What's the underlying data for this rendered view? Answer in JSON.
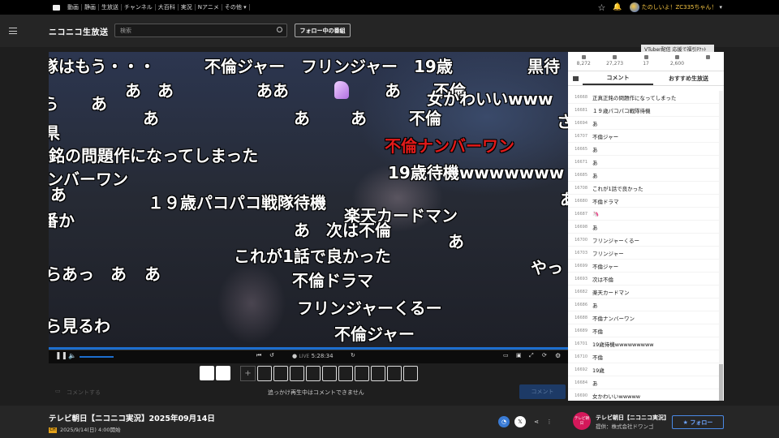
{
  "topbar": {
    "nav": [
      "動画",
      "静画",
      "生放送",
      "チャンネル",
      "大百科",
      "実況",
      "Nアニメ",
      "その他"
    ],
    "user_name": "たのしいよ！ZC335ちゃん！"
  },
  "header": {
    "logo": "ニコニコ生放送",
    "search_placeholder": "検索",
    "follow_programs": "フォロー中の番組"
  },
  "video": {
    "comments": [
      {
        "text": "隊はもう・・・",
        "size": 20
      },
      {
        "text": "不倫ジャー　フリンジャー　19歳",
        "size": 20
      },
      {
        "text": "黒待",
        "size": 20
      },
      {
        "text": "あ　あ",
        "size": 20
      },
      {
        "text": "ああ",
        "size": 20
      },
      {
        "text": "あ",
        "size": 20
      },
      {
        "text": "不倫",
        "size": 20
      },
      {
        "text": "あ",
        "size": 20
      },
      {
        "text": "女かわいいwww",
        "size": 20
      },
      {
        "text": "あ",
        "size": 20
      },
      {
        "text": "あ",
        "size": 20
      },
      {
        "text": "あ",
        "size": 20
      },
      {
        "text": "不倫",
        "size": 20
      },
      {
        "text": "不倫ナンバーワン",
        "size": 20,
        "color": "red"
      },
      {
        "text": "銘の問題作になってしまった",
        "size": 20
      },
      {
        "text": "19歳待機wwwwwww",
        "size": 20
      },
      {
        "text": "ンバーワン",
        "size": 20
      },
      {
        "text": "あ",
        "size": 20
      },
      {
        "text": "１９歳パコパコ戦隊待機",
        "size": 20
      },
      {
        "text": "番か",
        "size": 20
      },
      {
        "text": "楽天カードマン",
        "size": 20
      },
      {
        "text": "あ　次は不倫",
        "size": 20
      },
      {
        "text": "あ",
        "size": 20
      },
      {
        "text": "これが1話で良かった",
        "size": 20
      },
      {
        "text": "らあっ　あ",
        "size": 20
      },
      {
        "text": "やっ",
        "size": 20
      },
      {
        "text": "不倫ドラマ",
        "size": 20
      },
      {
        "text": "フリンジャーくるー",
        "size": 20
      },
      {
        "text": "ら見るわ",
        "size": 20
      },
      {
        "text": "不倫ジャー",
        "size": 20
      },
      {
        "text": "さ",
        "size": 20
      },
      {
        "text": "あ",
        "size": 20
      },
      {
        "text": "あ",
        "size": 20
      }
    ],
    "live_label": "LIVE",
    "time": "5:28:34"
  },
  "comment_bar": {
    "placeholder": "コメントする",
    "disabled_msg": "追っかけ再生中はコメントできません",
    "submit": "コメント"
  },
  "side": {
    "vtuber_banner": "VTuber配信 応援で福引ﾁｹｯﾄ",
    "stats": [
      "8,272",
      "27,273",
      "17",
      "2,600"
    ],
    "tab_comments": "コメント",
    "tab_recommended": "おすすめ生放送",
    "comments": [
      {
        "no": "16668",
        "text": "正真正銘の問題作になってしまった"
      },
      {
        "no": "16681",
        "text": "１９歳パコパコ戦隊待機"
      },
      {
        "no": "16694",
        "text": "あ"
      },
      {
        "no": "16707",
        "text": "不倫ジャー"
      },
      {
        "no": "16665",
        "text": "あ"
      },
      {
        "no": "16671",
        "text": "あ"
      },
      {
        "no": "16685",
        "text": "あ"
      },
      {
        "no": "16708",
        "text": "これが1話で良かった"
      },
      {
        "no": "16680",
        "text": "不倫ドラマ"
      },
      {
        "no": "16687",
        "text": "🦄"
      },
      {
        "no": "16698",
        "text": "あ"
      },
      {
        "no": "16700",
        "text": "フリンジャーくるー"
      },
      {
        "no": "16703",
        "text": "フリンジャー"
      },
      {
        "no": "16699",
        "text": "不倫ジャー"
      },
      {
        "no": "16693",
        "text": "次は不倫"
      },
      {
        "no": "16682",
        "text": "楽天カードマン"
      },
      {
        "no": "16686",
        "text": "あ"
      },
      {
        "no": "16688",
        "text": "不倫ナンバーワン"
      },
      {
        "no": "16689",
        "text": "不倫"
      },
      {
        "no": "16701",
        "text": "19歳待機wwwwwwwww"
      },
      {
        "no": "16710",
        "text": "不倫"
      },
      {
        "no": "16692",
        "text": "19歳"
      },
      {
        "no": "16684",
        "text": "あ"
      },
      {
        "no": "16690",
        "text": "女かわいいwwwww"
      }
    ]
  },
  "footer": {
    "title": "テレビ朝日【ニコニコ実況】2025年09月14日",
    "cs_badge": "CH",
    "date": "2025/9/14(日) 4:00開始",
    "provider_logo": "テレビ朝日",
    "provider_name": "テレビ朝日【ニコニコ実況】",
    "provider_sub": "提供：株式会社ドワンゴ",
    "follow": "★ フォロー"
  },
  "colors": {
    "accent": "#1d6ecf",
    "danmaku_red": "#e21a1a"
  }
}
